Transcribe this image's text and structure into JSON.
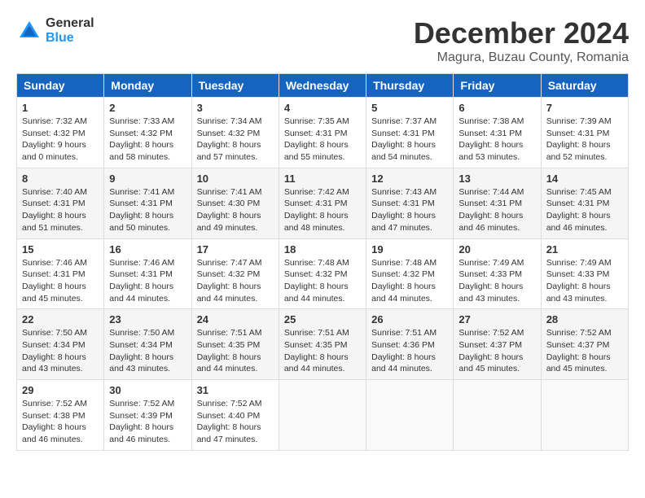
{
  "header": {
    "logo_general": "General",
    "logo_blue": "Blue",
    "month_title": "December 2024",
    "location": "Magura, Buzau County, Romania"
  },
  "columns": [
    "Sunday",
    "Monday",
    "Tuesday",
    "Wednesday",
    "Thursday",
    "Friday",
    "Saturday"
  ],
  "weeks": [
    [
      {
        "day": "1",
        "sunrise": "Sunrise: 7:32 AM",
        "sunset": "Sunset: 4:32 PM",
        "daylight": "Daylight: 9 hours and 0 minutes."
      },
      {
        "day": "2",
        "sunrise": "Sunrise: 7:33 AM",
        "sunset": "Sunset: 4:32 PM",
        "daylight": "Daylight: 8 hours and 58 minutes."
      },
      {
        "day": "3",
        "sunrise": "Sunrise: 7:34 AM",
        "sunset": "Sunset: 4:32 PM",
        "daylight": "Daylight: 8 hours and 57 minutes."
      },
      {
        "day": "4",
        "sunrise": "Sunrise: 7:35 AM",
        "sunset": "Sunset: 4:31 PM",
        "daylight": "Daylight: 8 hours and 55 minutes."
      },
      {
        "day": "5",
        "sunrise": "Sunrise: 7:37 AM",
        "sunset": "Sunset: 4:31 PM",
        "daylight": "Daylight: 8 hours and 54 minutes."
      },
      {
        "day": "6",
        "sunrise": "Sunrise: 7:38 AM",
        "sunset": "Sunset: 4:31 PM",
        "daylight": "Daylight: 8 hours and 53 minutes."
      },
      {
        "day": "7",
        "sunrise": "Sunrise: 7:39 AM",
        "sunset": "Sunset: 4:31 PM",
        "daylight": "Daylight: 8 hours and 52 minutes."
      }
    ],
    [
      {
        "day": "8",
        "sunrise": "Sunrise: 7:40 AM",
        "sunset": "Sunset: 4:31 PM",
        "daylight": "Daylight: 8 hours and 51 minutes."
      },
      {
        "day": "9",
        "sunrise": "Sunrise: 7:41 AM",
        "sunset": "Sunset: 4:31 PM",
        "daylight": "Daylight: 8 hours and 50 minutes."
      },
      {
        "day": "10",
        "sunrise": "Sunrise: 7:41 AM",
        "sunset": "Sunset: 4:30 PM",
        "daylight": "Daylight: 8 hours and 49 minutes."
      },
      {
        "day": "11",
        "sunrise": "Sunrise: 7:42 AM",
        "sunset": "Sunset: 4:31 PM",
        "daylight": "Daylight: 8 hours and 48 minutes."
      },
      {
        "day": "12",
        "sunrise": "Sunrise: 7:43 AM",
        "sunset": "Sunset: 4:31 PM",
        "daylight": "Daylight: 8 hours and 47 minutes."
      },
      {
        "day": "13",
        "sunrise": "Sunrise: 7:44 AM",
        "sunset": "Sunset: 4:31 PM",
        "daylight": "Daylight: 8 hours and 46 minutes."
      },
      {
        "day": "14",
        "sunrise": "Sunrise: 7:45 AM",
        "sunset": "Sunset: 4:31 PM",
        "daylight": "Daylight: 8 hours and 46 minutes."
      }
    ],
    [
      {
        "day": "15",
        "sunrise": "Sunrise: 7:46 AM",
        "sunset": "Sunset: 4:31 PM",
        "daylight": "Daylight: 8 hours and 45 minutes."
      },
      {
        "day": "16",
        "sunrise": "Sunrise: 7:46 AM",
        "sunset": "Sunset: 4:31 PM",
        "daylight": "Daylight: 8 hours and 44 minutes."
      },
      {
        "day": "17",
        "sunrise": "Sunrise: 7:47 AM",
        "sunset": "Sunset: 4:32 PM",
        "daylight": "Daylight: 8 hours and 44 minutes."
      },
      {
        "day": "18",
        "sunrise": "Sunrise: 7:48 AM",
        "sunset": "Sunset: 4:32 PM",
        "daylight": "Daylight: 8 hours and 44 minutes."
      },
      {
        "day": "19",
        "sunrise": "Sunrise: 7:48 AM",
        "sunset": "Sunset: 4:32 PM",
        "daylight": "Daylight: 8 hours and 44 minutes."
      },
      {
        "day": "20",
        "sunrise": "Sunrise: 7:49 AM",
        "sunset": "Sunset: 4:33 PM",
        "daylight": "Daylight: 8 hours and 43 minutes."
      },
      {
        "day": "21",
        "sunrise": "Sunrise: 7:49 AM",
        "sunset": "Sunset: 4:33 PM",
        "daylight": "Daylight: 8 hours and 43 minutes."
      }
    ],
    [
      {
        "day": "22",
        "sunrise": "Sunrise: 7:50 AM",
        "sunset": "Sunset: 4:34 PM",
        "daylight": "Daylight: 8 hours and 43 minutes."
      },
      {
        "day": "23",
        "sunrise": "Sunrise: 7:50 AM",
        "sunset": "Sunset: 4:34 PM",
        "daylight": "Daylight: 8 hours and 43 minutes."
      },
      {
        "day": "24",
        "sunrise": "Sunrise: 7:51 AM",
        "sunset": "Sunset: 4:35 PM",
        "daylight": "Daylight: 8 hours and 44 minutes."
      },
      {
        "day": "25",
        "sunrise": "Sunrise: 7:51 AM",
        "sunset": "Sunset: 4:35 PM",
        "daylight": "Daylight: 8 hours and 44 minutes."
      },
      {
        "day": "26",
        "sunrise": "Sunrise: 7:51 AM",
        "sunset": "Sunset: 4:36 PM",
        "daylight": "Daylight: 8 hours and 44 minutes."
      },
      {
        "day": "27",
        "sunrise": "Sunrise: 7:52 AM",
        "sunset": "Sunset: 4:37 PM",
        "daylight": "Daylight: 8 hours and 45 minutes."
      },
      {
        "day": "28",
        "sunrise": "Sunrise: 7:52 AM",
        "sunset": "Sunset: 4:37 PM",
        "daylight": "Daylight: 8 hours and 45 minutes."
      }
    ],
    [
      {
        "day": "29",
        "sunrise": "Sunrise: 7:52 AM",
        "sunset": "Sunset: 4:38 PM",
        "daylight": "Daylight: 8 hours and 46 minutes."
      },
      {
        "day": "30",
        "sunrise": "Sunrise: 7:52 AM",
        "sunset": "Sunset: 4:39 PM",
        "daylight": "Daylight: 8 hours and 46 minutes."
      },
      {
        "day": "31",
        "sunrise": "Sunrise: 7:52 AM",
        "sunset": "Sunset: 4:40 PM",
        "daylight": "Daylight: 8 hours and 47 minutes."
      },
      null,
      null,
      null,
      null
    ]
  ]
}
